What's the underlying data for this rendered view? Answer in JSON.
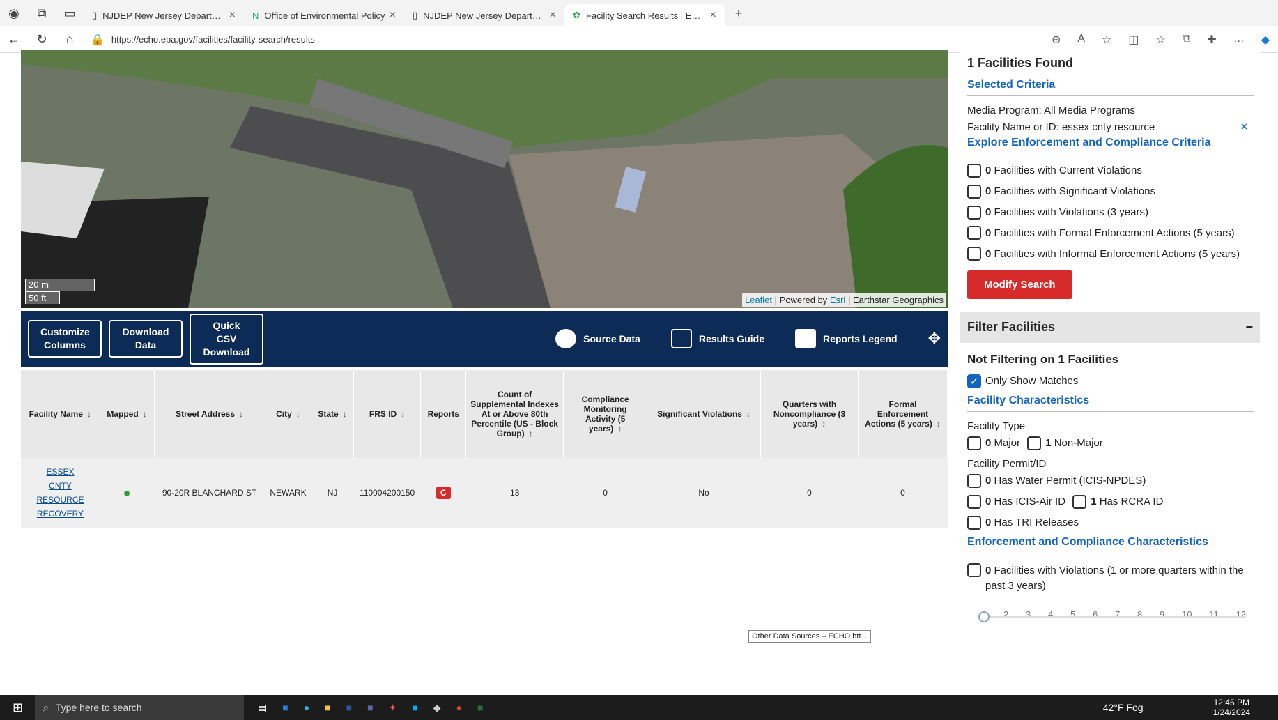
{
  "tabs": [
    "NJDEP New Jersey Department c",
    "Office of Environmental Policy",
    "NJDEP New Jersey Department c",
    "Facility Search Results | ECHO | U"
  ],
  "url": "https://echo.epa.gov/facilities/facility-search/results",
  "map": {
    "scale_m": "20 m",
    "scale_ft": "50 ft",
    "attr_leaflet": "Leaflet",
    "attr_powered": "| Powered by",
    "attr_esri": "Esri",
    "attr_tail": "| Earthstar Geographics"
  },
  "band": {
    "customize": "Customize Columns",
    "download": "Download Data",
    "csv": "Quick CSV Download",
    "source": "Source Data",
    "guide": "Results Guide",
    "legend": "Reports Legend"
  },
  "table": {
    "headers": [
      "Facility Name",
      "Mapped",
      "Street Address",
      "City",
      "State",
      "FRS ID",
      "Reports",
      "Count of Supplemental Indexes At or Above 80th Percentile (US - Block Group)",
      "Compliance Monitoring Activity (5 years)",
      "Significant Violations",
      "Quarters with Noncompliance (3 years)",
      "Formal Enforcement Actions (5 years)"
    ],
    "row": {
      "name": "ESSEX CNTY RESOURCE RECOVERY",
      "address": "90-20R BLANCHARD ST",
      "city": "NEWARK",
      "state": "NJ",
      "frs": "110004200150",
      "report": "C",
      "supp": "13",
      "cma": "0",
      "sig": "No",
      "quarters": "0",
      "formal": "0"
    }
  },
  "side": {
    "found": "1 Facilities Found",
    "selected": "Selected Criteria",
    "media": "Media Program: All Media Programs",
    "name": "Facility Name or ID: essex cnty resource",
    "explore": "Explore Enforcement and Compliance Criteria",
    "crit": [
      {
        "n": "0",
        "t": "Facilities with Current Violations"
      },
      {
        "n": "0",
        "t": "Facilities with Significant Violations"
      },
      {
        "n": "0",
        "t": "Facilities with Violations (3 years)"
      },
      {
        "n": "0",
        "t": "Facilities with Formal Enforcement Actions (5 years)"
      },
      {
        "n": "0",
        "t": "Facilities with Informal Enforcement Actions (5 years)"
      }
    ],
    "modify": "Modify Search",
    "filter": "Filter Facilities",
    "notfilter": "Not Filtering on 1 Facilities",
    "only": "Only Show Matches",
    "fchar": "Facility Characteristics",
    "ftype": "Facility Type",
    "major_n": "0",
    "major": "Major",
    "nonmajor_n": "1",
    "nonmajor": "Non-Major",
    "permit": "Facility Permit/ID",
    "water_n": "0",
    "water": "Has Water Permit (ICIS-NPDES)",
    "air_n": "0",
    "air": "Has ICIS-Air ID",
    "rcra_n": "1",
    "rcra": "Has RCRA ID",
    "tri_n": "0",
    "tri": "Has TRI Releases",
    "ecc": "Enforcement and Compliance Characteristics",
    "viol_n": "0",
    "viol": "Facilities with Violations (1 or more quarters within the past 3 years)",
    "ticks": [
      "1",
      "2",
      "3",
      "4",
      "5",
      "6",
      "7",
      "8",
      "9",
      "10",
      "11",
      "12"
    ]
  },
  "tooltip": "Other Data Sources – ECHO htt...",
  "taskbar": {
    "search": "Type here to search",
    "weather": "42°F Fog",
    "time": "12:45 PM",
    "date": "1/24/2024"
  }
}
